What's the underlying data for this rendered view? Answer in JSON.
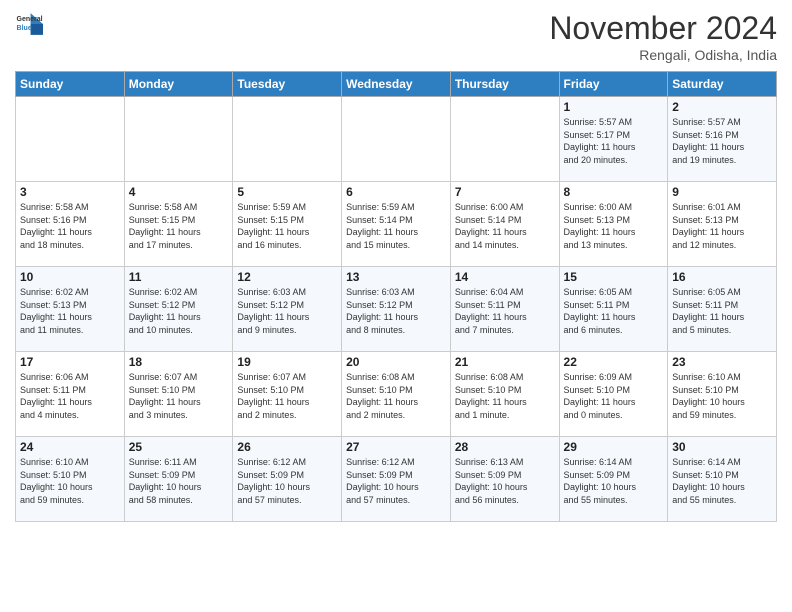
{
  "header": {
    "logo_line1": "General",
    "logo_line2": "Blue",
    "month": "November 2024",
    "location": "Rengali, Odisha, India"
  },
  "days_of_week": [
    "Sunday",
    "Monday",
    "Tuesday",
    "Wednesday",
    "Thursday",
    "Friday",
    "Saturday"
  ],
  "weeks": [
    [
      {
        "day": "",
        "info": ""
      },
      {
        "day": "",
        "info": ""
      },
      {
        "day": "",
        "info": ""
      },
      {
        "day": "",
        "info": ""
      },
      {
        "day": "",
        "info": ""
      },
      {
        "day": "1",
        "info": "Sunrise: 5:57 AM\nSunset: 5:17 PM\nDaylight: 11 hours\nand 20 minutes."
      },
      {
        "day": "2",
        "info": "Sunrise: 5:57 AM\nSunset: 5:16 PM\nDaylight: 11 hours\nand 19 minutes."
      }
    ],
    [
      {
        "day": "3",
        "info": "Sunrise: 5:58 AM\nSunset: 5:16 PM\nDaylight: 11 hours\nand 18 minutes."
      },
      {
        "day": "4",
        "info": "Sunrise: 5:58 AM\nSunset: 5:15 PM\nDaylight: 11 hours\nand 17 minutes."
      },
      {
        "day": "5",
        "info": "Sunrise: 5:59 AM\nSunset: 5:15 PM\nDaylight: 11 hours\nand 16 minutes."
      },
      {
        "day": "6",
        "info": "Sunrise: 5:59 AM\nSunset: 5:14 PM\nDaylight: 11 hours\nand 15 minutes."
      },
      {
        "day": "7",
        "info": "Sunrise: 6:00 AM\nSunset: 5:14 PM\nDaylight: 11 hours\nand 14 minutes."
      },
      {
        "day": "8",
        "info": "Sunrise: 6:00 AM\nSunset: 5:13 PM\nDaylight: 11 hours\nand 13 minutes."
      },
      {
        "day": "9",
        "info": "Sunrise: 6:01 AM\nSunset: 5:13 PM\nDaylight: 11 hours\nand 12 minutes."
      }
    ],
    [
      {
        "day": "10",
        "info": "Sunrise: 6:02 AM\nSunset: 5:13 PM\nDaylight: 11 hours\nand 11 minutes."
      },
      {
        "day": "11",
        "info": "Sunrise: 6:02 AM\nSunset: 5:12 PM\nDaylight: 11 hours\nand 10 minutes."
      },
      {
        "day": "12",
        "info": "Sunrise: 6:03 AM\nSunset: 5:12 PM\nDaylight: 11 hours\nand 9 minutes."
      },
      {
        "day": "13",
        "info": "Sunrise: 6:03 AM\nSunset: 5:12 PM\nDaylight: 11 hours\nand 8 minutes."
      },
      {
        "day": "14",
        "info": "Sunrise: 6:04 AM\nSunset: 5:11 PM\nDaylight: 11 hours\nand 7 minutes."
      },
      {
        "day": "15",
        "info": "Sunrise: 6:05 AM\nSunset: 5:11 PM\nDaylight: 11 hours\nand 6 minutes."
      },
      {
        "day": "16",
        "info": "Sunrise: 6:05 AM\nSunset: 5:11 PM\nDaylight: 11 hours\nand 5 minutes."
      }
    ],
    [
      {
        "day": "17",
        "info": "Sunrise: 6:06 AM\nSunset: 5:11 PM\nDaylight: 11 hours\nand 4 minutes."
      },
      {
        "day": "18",
        "info": "Sunrise: 6:07 AM\nSunset: 5:10 PM\nDaylight: 11 hours\nand 3 minutes."
      },
      {
        "day": "19",
        "info": "Sunrise: 6:07 AM\nSunset: 5:10 PM\nDaylight: 11 hours\nand 2 minutes."
      },
      {
        "day": "20",
        "info": "Sunrise: 6:08 AM\nSunset: 5:10 PM\nDaylight: 11 hours\nand 2 minutes."
      },
      {
        "day": "21",
        "info": "Sunrise: 6:08 AM\nSunset: 5:10 PM\nDaylight: 11 hours\nand 1 minute."
      },
      {
        "day": "22",
        "info": "Sunrise: 6:09 AM\nSunset: 5:10 PM\nDaylight: 11 hours\nand 0 minutes."
      },
      {
        "day": "23",
        "info": "Sunrise: 6:10 AM\nSunset: 5:10 PM\nDaylight: 10 hours\nand 59 minutes."
      }
    ],
    [
      {
        "day": "24",
        "info": "Sunrise: 6:10 AM\nSunset: 5:10 PM\nDaylight: 10 hours\nand 59 minutes."
      },
      {
        "day": "25",
        "info": "Sunrise: 6:11 AM\nSunset: 5:09 PM\nDaylight: 10 hours\nand 58 minutes."
      },
      {
        "day": "26",
        "info": "Sunrise: 6:12 AM\nSunset: 5:09 PM\nDaylight: 10 hours\nand 57 minutes."
      },
      {
        "day": "27",
        "info": "Sunrise: 6:12 AM\nSunset: 5:09 PM\nDaylight: 10 hours\nand 57 minutes."
      },
      {
        "day": "28",
        "info": "Sunrise: 6:13 AM\nSunset: 5:09 PM\nDaylight: 10 hours\nand 56 minutes."
      },
      {
        "day": "29",
        "info": "Sunrise: 6:14 AM\nSunset: 5:09 PM\nDaylight: 10 hours\nand 55 minutes."
      },
      {
        "day": "30",
        "info": "Sunrise: 6:14 AM\nSunset: 5:10 PM\nDaylight: 10 hours\nand 55 minutes."
      }
    ]
  ]
}
